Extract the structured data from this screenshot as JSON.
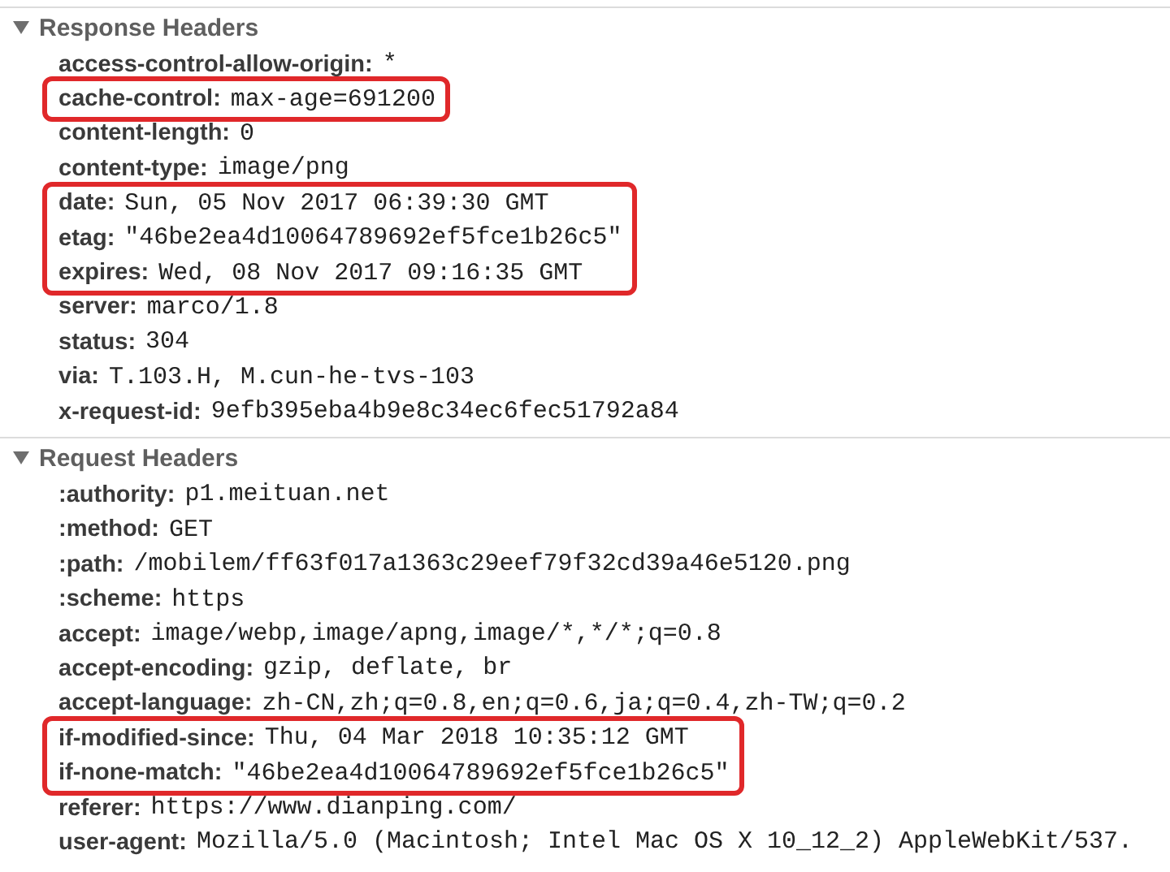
{
  "sections": [
    {
      "title": "Response Headers",
      "expanded": true,
      "headers": [
        {
          "name": "access-control-allow-origin:",
          "value": "*",
          "highlighted": false
        },
        {
          "name": "cache-control:",
          "value": "max-age=691200",
          "highlighted": true
        },
        {
          "name": "content-length:",
          "value": "0",
          "highlighted": false
        },
        {
          "name": "content-type:",
          "value": "image/png",
          "highlighted": false
        },
        {
          "name": "date:",
          "value": "Sun, 05 Nov 2017 06:39:30 GMT",
          "highlighted": true
        },
        {
          "name": "etag:",
          "value": "\"46be2ea4d10064789692ef5fce1b26c5\"",
          "highlighted": true
        },
        {
          "name": "expires:",
          "value": "Wed, 08 Nov 2017 09:16:35 GMT",
          "highlighted": true
        },
        {
          "name": "server:",
          "value": "marco/1.8",
          "highlighted": false
        },
        {
          "name": "status:",
          "value": "304",
          "highlighted": false
        },
        {
          "name": "via:",
          "value": "T.103.H, M.cun-he-tvs-103",
          "highlighted": false
        },
        {
          "name": "x-request-id:",
          "value": "9efb395eba4b9e8c34ec6fec51792a84",
          "highlighted": false
        }
      ]
    },
    {
      "title": "Request Headers",
      "expanded": true,
      "headers": [
        {
          "name": ":authority:",
          "value": "p1.meituan.net",
          "highlighted": false
        },
        {
          "name": ":method:",
          "value": "GET",
          "highlighted": false
        },
        {
          "name": ":path:",
          "value": "/mobilem/ff63f017a1363c29eef79f32cd39a46e5120.png",
          "highlighted": false
        },
        {
          "name": ":scheme:",
          "value": "https",
          "highlighted": false
        },
        {
          "name": "accept:",
          "value": "image/webp,image/apng,image/*,*/*;q=0.8",
          "highlighted": false
        },
        {
          "name": "accept-encoding:",
          "value": "gzip, deflate, br",
          "highlighted": false
        },
        {
          "name": "accept-language:",
          "value": "zh-CN,zh;q=0.8,en;q=0.6,ja;q=0.4,zh-TW;q=0.2",
          "highlighted": false
        },
        {
          "name": "if-modified-since:",
          "value": "Thu, 04 Mar 2018 10:35:12 GMT",
          "highlighted": true
        },
        {
          "name": "if-none-match:",
          "value": "\"46be2ea4d10064789692ef5fce1b26c5\"",
          "highlighted": true
        },
        {
          "name": "referer:",
          "value": "https://www.dianping.com/",
          "highlighted": false
        },
        {
          "name": "user-agent:",
          "value": "Mozilla/5.0 (Macintosh; Intel Mac OS X 10_12_2) AppleWebKit/537.",
          "highlighted": false
        }
      ]
    }
  ]
}
